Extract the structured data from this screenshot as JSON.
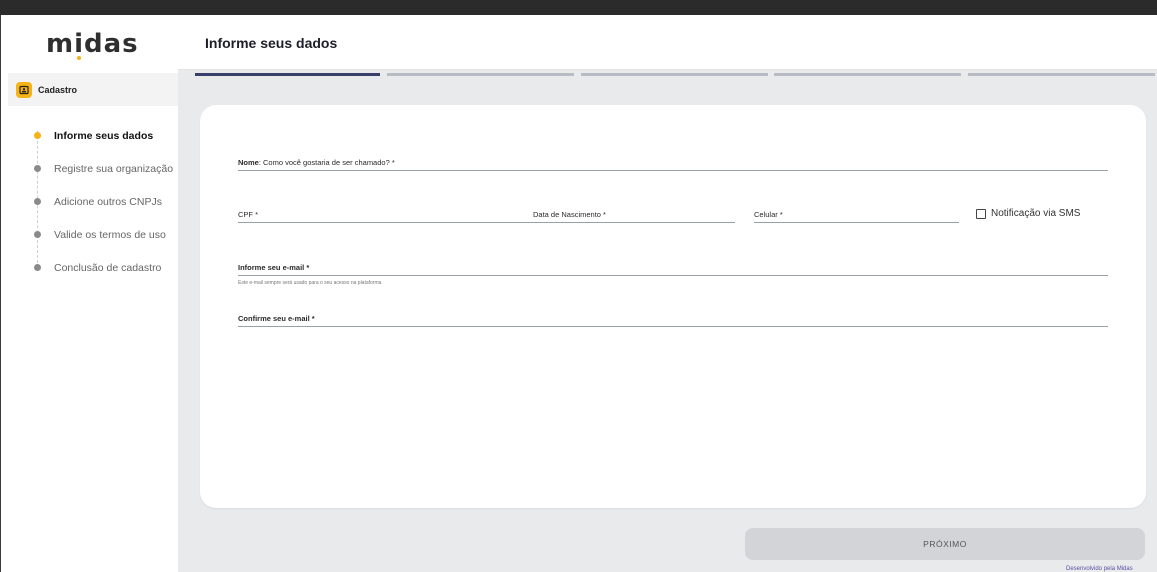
{
  "app": {
    "logo_text": "midas"
  },
  "sidebar": {
    "section_title": "Cadastro",
    "steps": [
      {
        "label": "Informe seus dados",
        "active": true
      },
      {
        "label": "Registre sua organização",
        "active": false
      },
      {
        "label": "Adicione outros CNPJs",
        "active": false
      },
      {
        "label": "Valide os termos de uso",
        "active": false
      },
      {
        "label": "Conclusão de cadastro",
        "active": false
      }
    ]
  },
  "header": {
    "title": "Informe seus dados"
  },
  "progress": {
    "total_steps": 5,
    "current_step": 1
  },
  "form": {
    "nome_label_bold": "Nome",
    "nome_label_rest": ": Como você gostaria de ser chamado? *",
    "nome_value": "",
    "cpf_label": "CPF *",
    "cpf_value": "",
    "nascimento_label": "Data de Nascimento *",
    "nascimento_value": "",
    "celular_label": "Celular *",
    "celular_value": "",
    "sms_label": "Notificação via SMS",
    "sms_checked": false,
    "email_label": "Informe seu e-mail *",
    "email_value": "",
    "email_helper": "Este e-mail sempre será usado para o seu acesso na plataforma",
    "email_confirm_label": "Confirme seu e-mail *",
    "email_confirm_value": ""
  },
  "actions": {
    "next_label": "PRÓXIMO"
  },
  "footer": {
    "credit": "Desenvolvido pela Midas"
  },
  "colors": {
    "accent": "#f5b316",
    "progress_active": "#3a3e6a",
    "progress_inactive": "#b8bcc4"
  }
}
